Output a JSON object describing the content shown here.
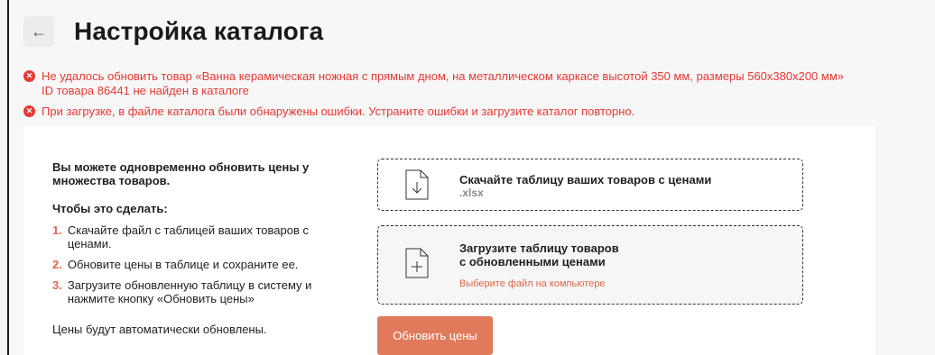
{
  "header": {
    "back_icon": "←",
    "title": "Настройка каталога"
  },
  "errors": [
    {
      "icon": "✕",
      "line1": "Не удалось обновить товар «Ванна керамическая ножная с прямым дном, на металлическом каркасе высотой 350 мм, размеры 560x380x200 мм»",
      "line2": "ID товара 86441 не найден в каталоге"
    },
    {
      "icon": "✕",
      "line1": "При загрузке, в файле каталога были обнаружены ошибки. Устраните ошибки и загрузите каталог повторно."
    }
  ],
  "instructions": {
    "intro": "Вы можете одновременно обновить цены у множества товаров.",
    "subhead": "Чтобы это сделать:",
    "steps": [
      {
        "num": "1.",
        "text": "Скачайте файл с таблицей ваших товаров с ценами."
      },
      {
        "num": "2.",
        "text": "Обновите цены в таблице и сохраните ее."
      },
      {
        "num": "3.",
        "text": "Загрузите обновленную таблицу в систему и нажмите кнопку «Обновить цены»"
      }
    ],
    "note": "Цены будут автоматически обновлены."
  },
  "download": {
    "title": "Скачайте таблицу ваших товаров с ценами",
    "format": ".xlsx",
    "icon": "download-file-icon"
  },
  "upload": {
    "title_line1": "Загрузите таблицу товаров",
    "title_line2": "с обновленными ценами",
    "link": "Выберите файл на компьютере",
    "icon": "upload-file-icon"
  },
  "actions": {
    "update_label": "Обновить цены"
  },
  "colors": {
    "error": "#e53935",
    "accent": "#e0674a",
    "button": "#e07a5a"
  }
}
